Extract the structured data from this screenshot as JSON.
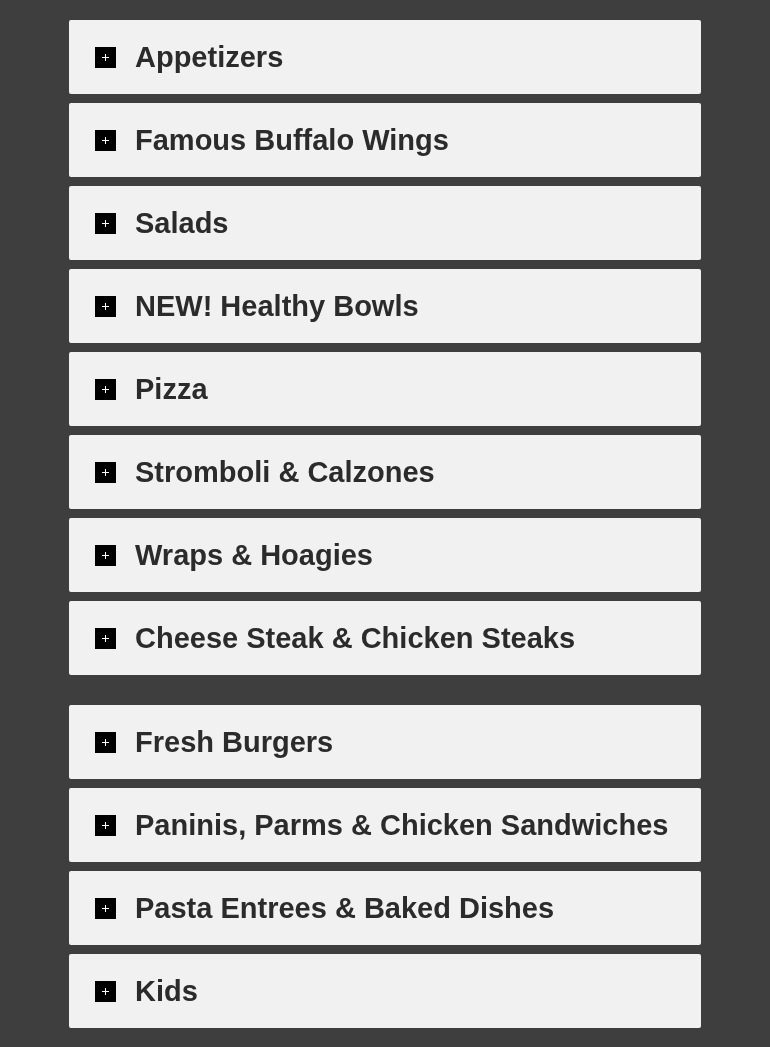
{
  "menu_groups": [
    {
      "sections": [
        {
          "title": "Appetizers",
          "expanded": false
        },
        {
          "title": "Famous Buffalo Wings",
          "expanded": false
        },
        {
          "title": "Salads",
          "expanded": false
        },
        {
          "title": "NEW! Healthy Bowls",
          "expanded": false
        },
        {
          "title": "Pizza",
          "expanded": false
        },
        {
          "title": "Stromboli & Calzones",
          "expanded": false
        },
        {
          "title": "Wraps & Hoagies",
          "expanded": false
        },
        {
          "title": "Cheese Steak & Chicken Steaks",
          "expanded": false
        }
      ]
    },
    {
      "sections": [
        {
          "title": "Fresh Burgers",
          "expanded": false
        },
        {
          "title": "Paninis, Parms & Chicken Sandwiches",
          "expanded": false
        },
        {
          "title": "Pasta Entrees & Baked Dishes",
          "expanded": false
        },
        {
          "title": "Kids",
          "expanded": false
        }
      ]
    }
  ]
}
